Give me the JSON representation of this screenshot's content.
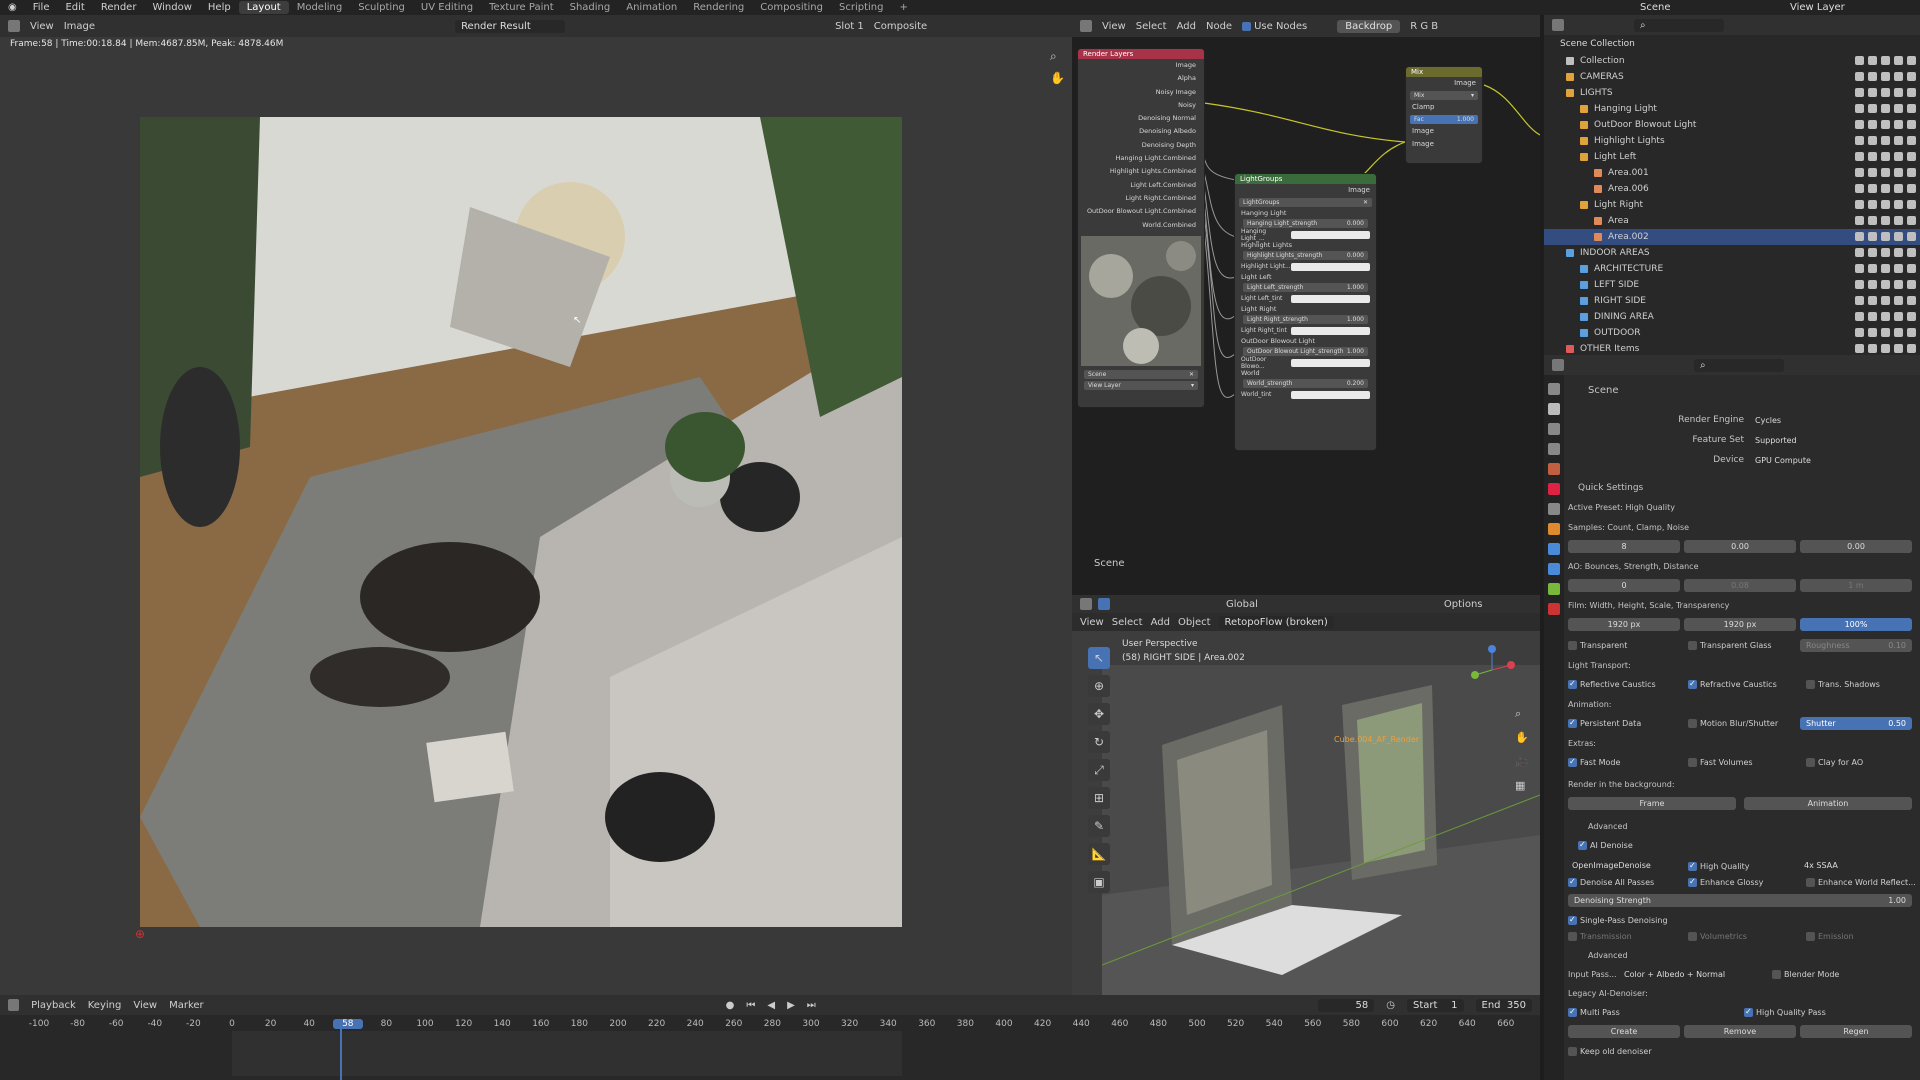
{
  "menu": {
    "items": [
      "File",
      "Edit",
      "Render",
      "Window",
      "Help"
    ],
    "workspaces": [
      "Layout",
      "Modeling",
      "Sculpting",
      "UV Editing",
      "Texture Paint",
      "Shading",
      "Animation",
      "Rendering",
      "Compositing",
      "Scripting"
    ],
    "add": "+",
    "scene_label": "Scene",
    "view_layer_label": "View Layer"
  },
  "image_editor": {
    "view": "View",
    "image": "Image",
    "render_name": "Render Result",
    "slot": "Slot 1",
    "pass": "Composite",
    "stats": "Frame:58 | Time:00:18.84 | Mem:4687.85M, Peak: 4878.46M"
  },
  "node_editor": {
    "menus": [
      "View",
      "Select",
      "Add",
      "Node"
    ],
    "use_nodes": "Use Nodes",
    "backdrop": "Backdrop",
    "channels": "R G B",
    "tree_label": "Scene",
    "render_layers": {
      "title": "Render Layers",
      "outputs": [
        "Image",
        "Alpha",
        "Noisy Image",
        "Noisy",
        "Denoising Normal",
        "Denoising Albedo",
        "Denoising Depth",
        "Hanging Light.Combined",
        "Highlight Lights.Combined",
        "Light Left.Combined",
        "Light Right.Combined",
        "OutDoor Blowout Light.Combined",
        "World.Combined"
      ],
      "scene": "Scene",
      "view_layer": "View Layer"
    },
    "mix": {
      "title": "Mix",
      "type": "Mix",
      "clamp": "Clamp",
      "fac": "Fac",
      "fac_value": "1.000",
      "out": "Image",
      "in1": "Image",
      "in2": "Image"
    },
    "lightgroups": {
      "title": "LightGroups",
      "group": "LightGroups",
      "out": "Image",
      "rows": [
        {
          "label": "Hanging Light"
        },
        {
          "label": "Hanging Light_strength",
          "value": "0.000",
          "bar": true
        },
        {
          "label": "Hanging Light_...",
          "white": true
        },
        {
          "label": "Highlight Lights"
        },
        {
          "label": "Highlight Lights_strength",
          "value": "0.000",
          "bar": true
        },
        {
          "label": "Highlight Light...",
          "white": true
        },
        {
          "label": "Light Left"
        },
        {
          "label": "Light Left_strength",
          "value": "1.000",
          "bar": true
        },
        {
          "label": "Light Left_tint",
          "white": true
        },
        {
          "label": "Light Right"
        },
        {
          "label": "Light Right_strength",
          "value": "1.000",
          "bar": true
        },
        {
          "label": "Light Right_tint",
          "white": true
        },
        {
          "label": "OutDoor Blowout Light"
        },
        {
          "label": "OutDoor Blowout Light_strength",
          "value": "1.000",
          "bar": true
        },
        {
          "label": "OutDoor Blowo...",
          "white": true
        },
        {
          "label": "World"
        },
        {
          "label": "World_strength",
          "value": "0.200",
          "bar": true
        },
        {
          "label": "World_tint",
          "white": true
        }
      ]
    }
  },
  "viewport": {
    "menus": [
      "View",
      "Select",
      "Add",
      "Object"
    ],
    "mode": "RetopoFlow (broken)",
    "orientation": "Global",
    "options": "Options",
    "perspective": "User Perspective",
    "context": "(58) RIGHT SIDE | Area.002",
    "object_label": "Cube.004_AF_Render"
  },
  "outliner": {
    "root": "Scene Collection",
    "rows": [
      {
        "label": "Collection",
        "indent": 1,
        "color": "#bfbfbf"
      },
      {
        "label": "CAMERAS",
        "indent": 1,
        "color": "#e0a23a"
      },
      {
        "label": "LIGHTS",
        "indent": 1,
        "color": "#e0a23a"
      },
      {
        "label": "Hanging Light",
        "indent": 2,
        "color": "#e0a23a"
      },
      {
        "label": "OutDoor Blowout Light",
        "indent": 2,
        "color": "#e0a23a"
      },
      {
        "label": "Highlight Lights",
        "indent": 2,
        "color": "#e0a23a"
      },
      {
        "label": "Light Left",
        "indent": 2,
        "color": "#e0a23a"
      },
      {
        "label": "Area.001",
        "indent": 3,
        "color": "#e08a5a"
      },
      {
        "label": "Area.006",
        "indent": 3,
        "color": "#e08a5a"
      },
      {
        "label": "Light Right",
        "indent": 2,
        "color": "#e0a23a"
      },
      {
        "label": "Area",
        "indent": 3,
        "color": "#e08a5a"
      },
      {
        "label": "Area.002",
        "indent": 3,
        "color": "#e08a5a",
        "selected": true
      },
      {
        "label": "INDOOR AREAS",
        "indent": 1,
        "color": "#5aa0e0"
      },
      {
        "label": "ARCHITECTURE",
        "indent": 2,
        "color": "#5aa0e0"
      },
      {
        "label": "LEFT SIDE",
        "indent": 2,
        "color": "#5aa0e0"
      },
      {
        "label": "RIGHT SIDE",
        "indent": 2,
        "color": "#5aa0e0"
      },
      {
        "label": "DINING AREA",
        "indent": 2,
        "color": "#5aa0e0"
      },
      {
        "label": "OUTDOOR",
        "indent": 2,
        "color": "#5aa0e0"
      },
      {
        "label": "OTHER Items",
        "indent": 1,
        "color": "#e05a5a"
      }
    ]
  },
  "properties": {
    "scene": "Scene",
    "render_engine_label": "Render Engine",
    "render_engine": "Cycles",
    "feature_set_label": "Feature Set",
    "feature_set": "Supported",
    "device_label": "Device",
    "device": "GPU Compute",
    "quick_settings": "Quick Settings",
    "active_preset": "Active Preset: High Quality",
    "samples_label": "Samples: Count, Clamp, Noise",
    "samples": [
      "8",
      "0.00",
      "0.00"
    ],
    "ao_label": "AO: Bounces, Strength, Distance",
    "ao": [
      "0",
      "0.08",
      "1 m"
    ],
    "film_label": "Film: Width, Height, Scale, Transparency",
    "film": [
      "1920 px",
      "1920 px",
      "100%"
    ],
    "transparent": "Transparent",
    "transparent_glass": "Transparent Glass",
    "roughness": "Roughness",
    "roughness_value": "0.10",
    "light_transport": "Light Transport:",
    "reflective_caustics": "Reflective Caustics",
    "refractive_caustics": "Refractive Caustics",
    "trans_shadows": "Trans. Shadows",
    "animation": "Animation:",
    "persistent_data": "Persistent Data",
    "motion_blur": "Motion Blur/Shutter",
    "shutter": "Shutter",
    "shutter_value": "0.50",
    "extras": "Extras:",
    "fast_mode": "Fast Mode",
    "fast_volumes": "Fast Volumes",
    "clay_ao": "Clay for AO",
    "render_bg": "Render in the background:",
    "frame_btn": "Frame",
    "animation_btn": "Animation",
    "advanced": "Advanced",
    "ai_denoise": "AI Denoise",
    "denoiser": "OpenImageDenoise",
    "high_quality": "High Quality",
    "ssaa": "4x SSAA",
    "denoise_all": "Denoise All Passes",
    "enhance_glossy": "Enhance Glossy",
    "enhance_world": "Enhance World Reflect...",
    "denoise_strength": "Denoising Strength",
    "denoise_strength_value": "1.00",
    "single_pass": "Single-Pass Denoising",
    "transmission": "Transmission",
    "volumetrics": "Volumetrics",
    "emission": "Emission",
    "advanced2": "Advanced",
    "input_pass_label": "Input Pass...",
    "input_pass": "Color + Albedo + Normal",
    "blender_mode": "Blender Mode",
    "legacy": "Legacy AI-Denoiser:",
    "multi_pass": "Multi Pass",
    "high_quality_pass": "High Quality Pass",
    "create": "Create",
    "remove": "Remove",
    "regen": "Regen",
    "keep_old": "Keep old denoiser"
  },
  "timeline": {
    "menus": [
      "Playback",
      "Keying",
      "View",
      "Marker"
    ],
    "current_frame": "58",
    "start_label": "Start",
    "start": "1",
    "end_label": "End",
    "end": "350",
    "ticks": [
      "-100",
      "-80",
      "-60",
      "-40",
      "-20",
      "0",
      "20",
      "40",
      "58",
      "80",
      "100",
      "120",
      "140",
      "160",
      "180",
      "200",
      "220",
      "240",
      "260",
      "280",
      "300",
      "320",
      "340",
      "360",
      "380",
      "400",
      "420",
      "440",
      "460",
      "480",
      "500",
      "520",
      "540",
      "560",
      "580",
      "600",
      "620",
      "640",
      "660"
    ]
  }
}
